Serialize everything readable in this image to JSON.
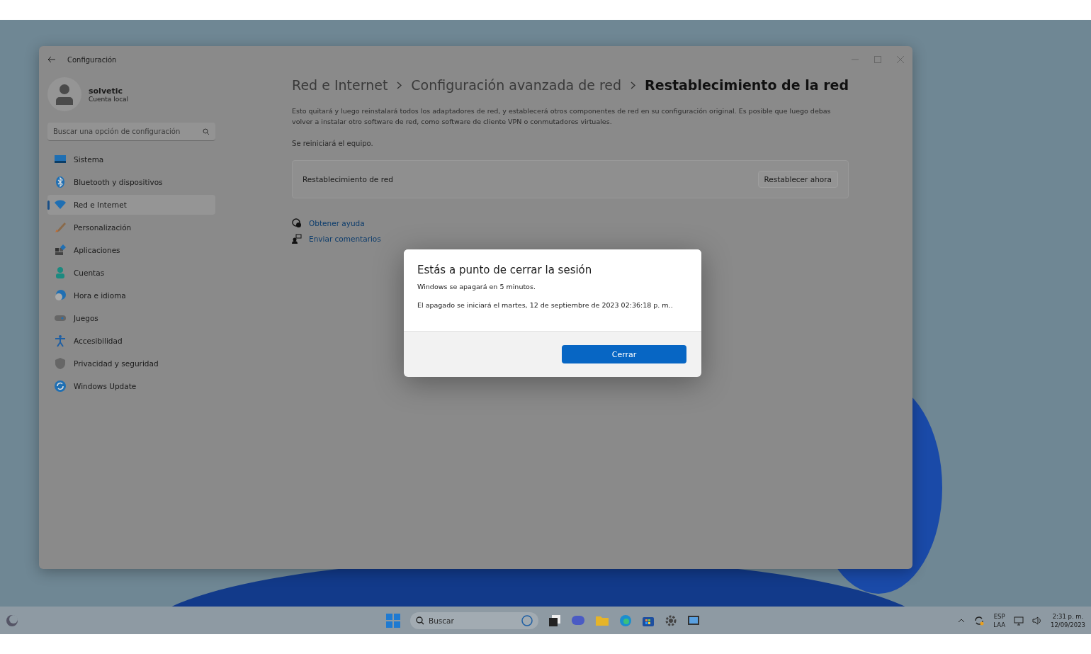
{
  "window": {
    "title": "Configuración"
  },
  "account": {
    "name": "solvetic",
    "type": "Cuenta local"
  },
  "search": {
    "placeholder": "Buscar una opción de configuración"
  },
  "sidebar": {
    "items": [
      {
        "label": "Sistema",
        "selected": false
      },
      {
        "label": "Bluetooth y dispositivos",
        "selected": false
      },
      {
        "label": "Red e Internet",
        "selected": true
      },
      {
        "label": "Personalización",
        "selected": false
      },
      {
        "label": "Aplicaciones",
        "selected": false
      },
      {
        "label": "Cuentas",
        "selected": false
      },
      {
        "label": "Hora e idioma",
        "selected": false
      },
      {
        "label": "Juegos",
        "selected": false
      },
      {
        "label": "Accesibilidad",
        "selected": false
      },
      {
        "label": "Privacidad y seguridad",
        "selected": false
      },
      {
        "label": "Windows Update",
        "selected": false
      }
    ]
  },
  "breadcrumb": [
    "Red e Internet",
    "Configuración avanzada de red",
    "Restablecimiento de la red"
  ],
  "description": "Esto quitará y luego reinstalará todos los adaptadores de red, y establecerá otros componentes de red en su configuración original. Es posible que luego debas volver a instalar otro software de red, como software de cliente VPN o conmutadores virtuales.",
  "note": "Se reiniciará el equipo.",
  "reset_card": {
    "label": "Restablecimiento de red",
    "button": "Restablecer ahora"
  },
  "links": [
    "Obtener ayuda",
    "Enviar comentarios"
  ],
  "dialog": {
    "title": "Estás a punto de cerrar la sesión",
    "lines": [
      "Windows se apagará en 5 minutos.",
      "El apagado se iniciará el martes, 12 de septiembre de 2023 02:36:18 p. m.."
    ],
    "button": "Cerrar"
  },
  "taskbar": {
    "search_placeholder": "Buscar",
    "language": [
      "ESP",
      "LAA"
    ],
    "time": "2:31 p. m.",
    "date": "12/09/2023"
  }
}
